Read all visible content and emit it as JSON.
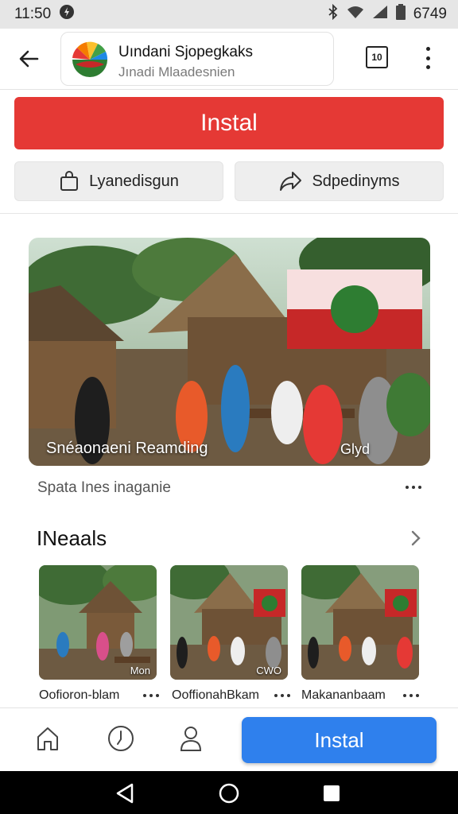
{
  "status": {
    "time": "11:50",
    "battery_text": "6749"
  },
  "app": {
    "title": "Uındani Sjopegkaks",
    "subtitle": "Jınadi Mlaadesnien",
    "tab_count": "10"
  },
  "install_top": "Instal",
  "actions": [
    {
      "label": "Lyanedisgun",
      "icon": "bag-icon"
    },
    {
      "label": "Sdpedinyms",
      "icon": "share-icon"
    }
  ],
  "hero": {
    "caption": "Snéaonaeni Reamding",
    "tag": "Glyd"
  },
  "photo_caption": "Spata Ines inaganie",
  "section_title": "INeaals",
  "thumbnails": [
    {
      "label": "Oofioron-blam",
      "tag": "Mon"
    },
    {
      "label": "OoffionahBkam",
      "tag": "CWO"
    },
    {
      "label": "Makananbaam",
      "tag": ""
    }
  ],
  "install_bottom": "Instal",
  "colors": {
    "install_red": "#e53935",
    "install_blue": "#2f80ed"
  }
}
